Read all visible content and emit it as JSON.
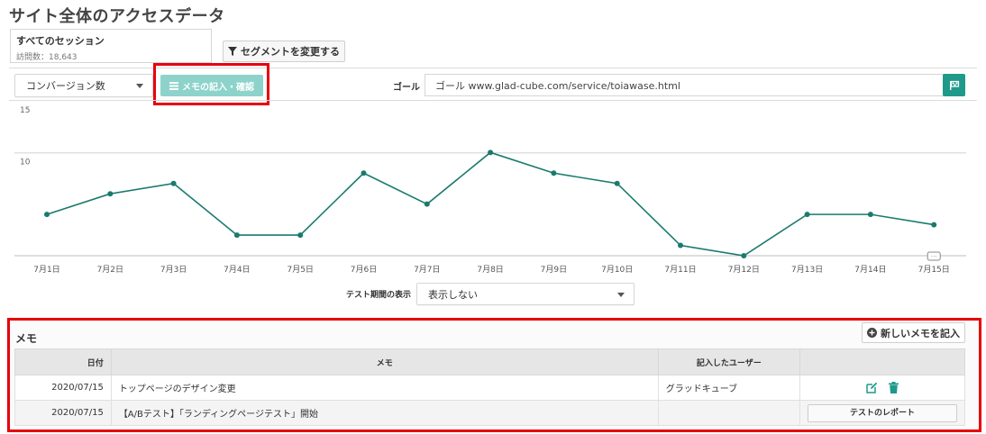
{
  "page": {
    "title": "サイト全体のアクセスデータ"
  },
  "session": {
    "title": "すべてのセッション",
    "subtitle": "訪問数：18,643"
  },
  "toolbar": {
    "segment_label": "セグメントを変更する",
    "conversion_select": "コンバージョン数",
    "memo_button": "メモの記入・確認",
    "goal_label": "ゴール",
    "goal_value": "ゴール www.glad-cube.com/service/toiawase.html"
  },
  "chart_data": {
    "type": "line",
    "categories": [
      "7月1日",
      "7月2日",
      "7月3日",
      "7月4日",
      "7月5日",
      "7月6日",
      "7月7日",
      "7月8日",
      "7月9日",
      "7月10日",
      "7月11日",
      "7月12日",
      "7月13日",
      "7月14日",
      "7月15日"
    ],
    "series": [
      {
        "values": [
          4,
          6,
          7,
          2,
          2,
          8,
          5,
          10,
          8,
          7,
          1,
          0,
          4,
          4,
          3
        ]
      }
    ],
    "y_ticks": [
      "15",
      "10"
    ],
    "ylim": [
      0,
      15
    ],
    "grid": true,
    "color": "#1a7a6e"
  },
  "test_period": {
    "label": "テスト期間の表示",
    "value": "表示しない"
  },
  "memo": {
    "heading": "メモ",
    "new_button": "新しいメモを記入",
    "columns": {
      "date": "日付",
      "memo": "メモ",
      "user": "記入したユーザー"
    },
    "rows": [
      {
        "date": "2020/07/15",
        "memo": "トップページのデザイン変更",
        "user": "グラッドキューブ"
      },
      {
        "date": "2020/07/15",
        "memo": "【A/Bテスト】「ランディングページテスト」開始",
        "user": "",
        "action": "テストのレポート"
      }
    ]
  },
  "colors": {
    "accent": "#1f9a8a",
    "memo_button": "#8dd3cb",
    "highlight": "#e8000b"
  }
}
